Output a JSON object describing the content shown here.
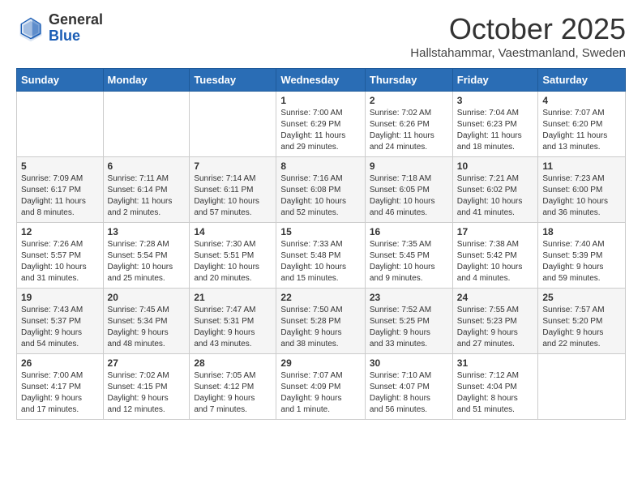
{
  "header": {
    "logo_general": "General",
    "logo_blue": "Blue",
    "month_title": "October 2025",
    "location": "Hallstahammar, Vaestmanland, Sweden"
  },
  "days_of_week": [
    "Sunday",
    "Monday",
    "Tuesday",
    "Wednesday",
    "Thursday",
    "Friday",
    "Saturday"
  ],
  "weeks": [
    [
      {
        "day": "",
        "info": ""
      },
      {
        "day": "",
        "info": ""
      },
      {
        "day": "",
        "info": ""
      },
      {
        "day": "1",
        "info": "Sunrise: 7:00 AM\nSunset: 6:29 PM\nDaylight: 11 hours\nand 29 minutes."
      },
      {
        "day": "2",
        "info": "Sunrise: 7:02 AM\nSunset: 6:26 PM\nDaylight: 11 hours\nand 24 minutes."
      },
      {
        "day": "3",
        "info": "Sunrise: 7:04 AM\nSunset: 6:23 PM\nDaylight: 11 hours\nand 18 minutes."
      },
      {
        "day": "4",
        "info": "Sunrise: 7:07 AM\nSunset: 6:20 PM\nDaylight: 11 hours\nand 13 minutes."
      }
    ],
    [
      {
        "day": "5",
        "info": "Sunrise: 7:09 AM\nSunset: 6:17 PM\nDaylight: 11 hours\nand 8 minutes."
      },
      {
        "day": "6",
        "info": "Sunrise: 7:11 AM\nSunset: 6:14 PM\nDaylight: 11 hours\nand 2 minutes."
      },
      {
        "day": "7",
        "info": "Sunrise: 7:14 AM\nSunset: 6:11 PM\nDaylight: 10 hours\nand 57 minutes."
      },
      {
        "day": "8",
        "info": "Sunrise: 7:16 AM\nSunset: 6:08 PM\nDaylight: 10 hours\nand 52 minutes."
      },
      {
        "day": "9",
        "info": "Sunrise: 7:18 AM\nSunset: 6:05 PM\nDaylight: 10 hours\nand 46 minutes."
      },
      {
        "day": "10",
        "info": "Sunrise: 7:21 AM\nSunset: 6:02 PM\nDaylight: 10 hours\nand 41 minutes."
      },
      {
        "day": "11",
        "info": "Sunrise: 7:23 AM\nSunset: 6:00 PM\nDaylight: 10 hours\nand 36 minutes."
      }
    ],
    [
      {
        "day": "12",
        "info": "Sunrise: 7:26 AM\nSunset: 5:57 PM\nDaylight: 10 hours\nand 31 minutes."
      },
      {
        "day": "13",
        "info": "Sunrise: 7:28 AM\nSunset: 5:54 PM\nDaylight: 10 hours\nand 25 minutes."
      },
      {
        "day": "14",
        "info": "Sunrise: 7:30 AM\nSunset: 5:51 PM\nDaylight: 10 hours\nand 20 minutes."
      },
      {
        "day": "15",
        "info": "Sunrise: 7:33 AM\nSunset: 5:48 PM\nDaylight: 10 hours\nand 15 minutes."
      },
      {
        "day": "16",
        "info": "Sunrise: 7:35 AM\nSunset: 5:45 PM\nDaylight: 10 hours\nand 9 minutes."
      },
      {
        "day": "17",
        "info": "Sunrise: 7:38 AM\nSunset: 5:42 PM\nDaylight: 10 hours\nand 4 minutes."
      },
      {
        "day": "18",
        "info": "Sunrise: 7:40 AM\nSunset: 5:39 PM\nDaylight: 9 hours\nand 59 minutes."
      }
    ],
    [
      {
        "day": "19",
        "info": "Sunrise: 7:43 AM\nSunset: 5:37 PM\nDaylight: 9 hours\nand 54 minutes."
      },
      {
        "day": "20",
        "info": "Sunrise: 7:45 AM\nSunset: 5:34 PM\nDaylight: 9 hours\nand 48 minutes."
      },
      {
        "day": "21",
        "info": "Sunrise: 7:47 AM\nSunset: 5:31 PM\nDaylight: 9 hours\nand 43 minutes."
      },
      {
        "day": "22",
        "info": "Sunrise: 7:50 AM\nSunset: 5:28 PM\nDaylight: 9 hours\nand 38 minutes."
      },
      {
        "day": "23",
        "info": "Sunrise: 7:52 AM\nSunset: 5:25 PM\nDaylight: 9 hours\nand 33 minutes."
      },
      {
        "day": "24",
        "info": "Sunrise: 7:55 AM\nSunset: 5:23 PM\nDaylight: 9 hours\nand 27 minutes."
      },
      {
        "day": "25",
        "info": "Sunrise: 7:57 AM\nSunset: 5:20 PM\nDaylight: 9 hours\nand 22 minutes."
      }
    ],
    [
      {
        "day": "26",
        "info": "Sunrise: 7:00 AM\nSunset: 4:17 PM\nDaylight: 9 hours\nand 17 minutes."
      },
      {
        "day": "27",
        "info": "Sunrise: 7:02 AM\nSunset: 4:15 PM\nDaylight: 9 hours\nand 12 minutes."
      },
      {
        "day": "28",
        "info": "Sunrise: 7:05 AM\nSunset: 4:12 PM\nDaylight: 9 hours\nand 7 minutes."
      },
      {
        "day": "29",
        "info": "Sunrise: 7:07 AM\nSunset: 4:09 PM\nDaylight: 9 hours\nand 1 minute."
      },
      {
        "day": "30",
        "info": "Sunrise: 7:10 AM\nSunset: 4:07 PM\nDaylight: 8 hours\nand 56 minutes."
      },
      {
        "day": "31",
        "info": "Sunrise: 7:12 AM\nSunset: 4:04 PM\nDaylight: 8 hours\nand 51 minutes."
      },
      {
        "day": "",
        "info": ""
      }
    ]
  ]
}
